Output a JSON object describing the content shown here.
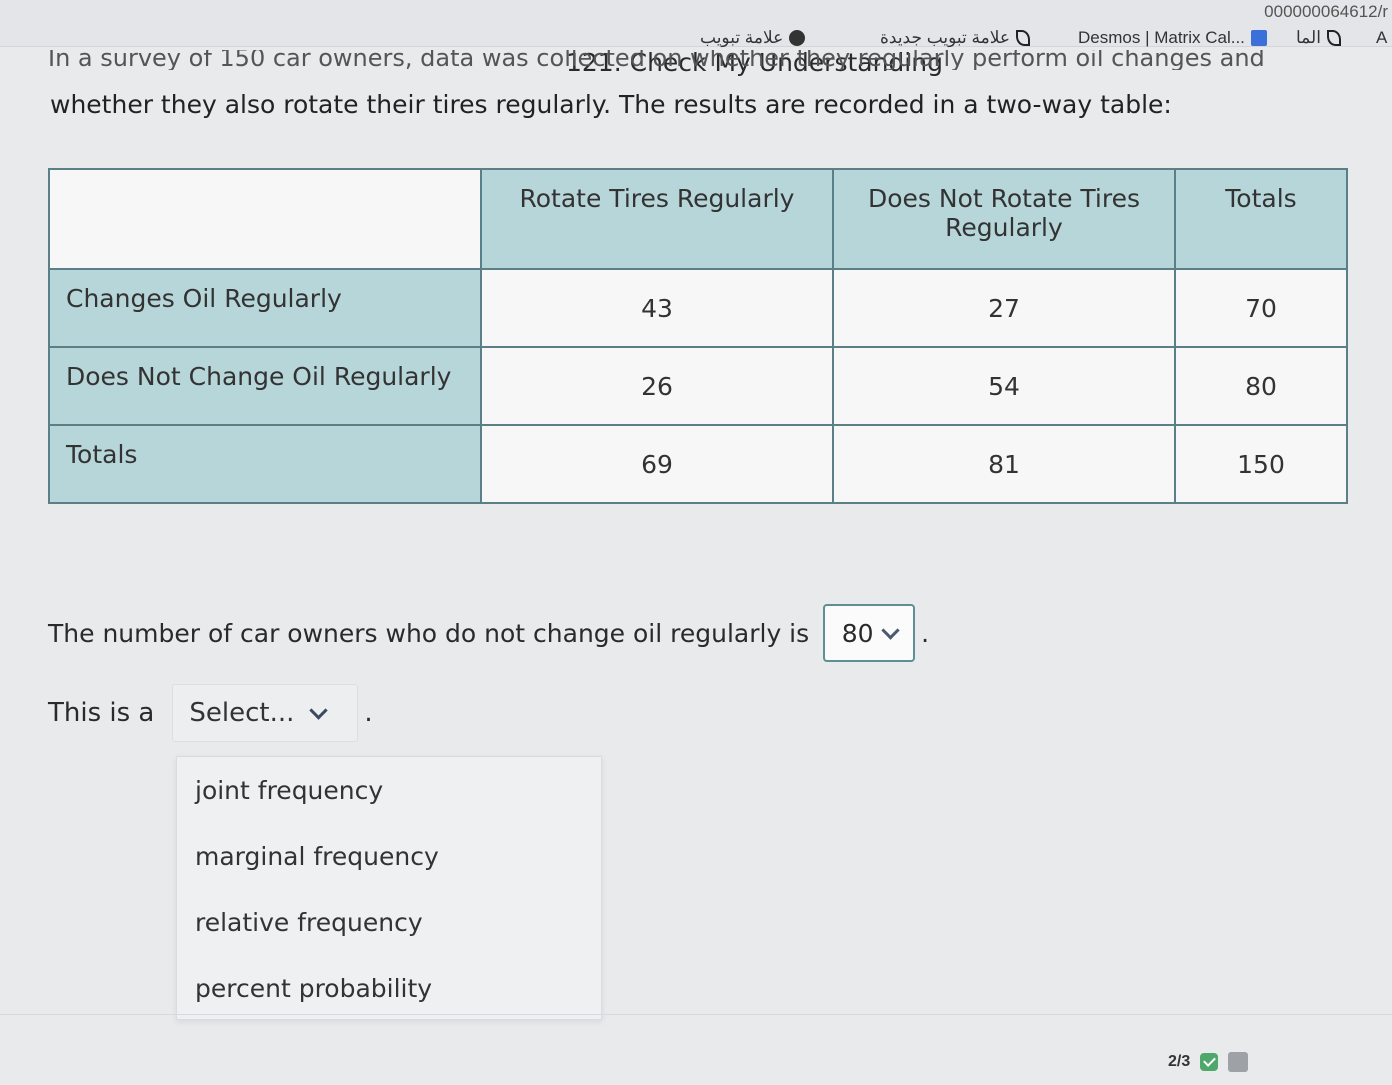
{
  "browser": {
    "url_fragment": "000000064612/r",
    "bookmarks": [
      {
        "label": "علامة تبويب",
        "icon": "globe-icon"
      },
      {
        "label": "علامة تبويب جديدة",
        "icon": "leaf-icon"
      },
      {
        "label": "Desmos | Matrix Cal...",
        "icon": "desmos-icon"
      },
      {
        "label": "الما",
        "icon": "leaf-icon"
      },
      {
        "label": "A",
        "icon": ""
      }
    ]
  },
  "question": {
    "title": "121. Check My Understanding",
    "intro_line1": "In a survey of 150 car owners, data was collected on whether they regularly perform oil changes and",
    "intro_line2": "whether they also rotate their tires regularly. The results are recorded in a two-way table:"
  },
  "table": {
    "columns": [
      "",
      "Rotate Tires Regularly",
      "Does Not Rotate Tires Regularly",
      "Totals"
    ],
    "rows": [
      {
        "label": "Changes Oil Regularly",
        "values": [
          "43",
          "27",
          "70"
        ]
      },
      {
        "label": "Does Not Change Oil Regularly",
        "values": [
          "26",
          "54",
          "80"
        ]
      },
      {
        "label": "Totals",
        "values": [
          "69",
          "81",
          "150"
        ]
      }
    ]
  },
  "sentence1": {
    "text": "The number of car owners who do not change oil regularly is",
    "selected": "80",
    "end": "."
  },
  "sentence2": {
    "text": "This is a",
    "placeholder": "Select...",
    "end": "."
  },
  "dropdown_options": [
    "joint frequency",
    "marginal frequency",
    "relative frequency",
    "percent probability"
  ],
  "pager": {
    "label": "2/3"
  }
}
